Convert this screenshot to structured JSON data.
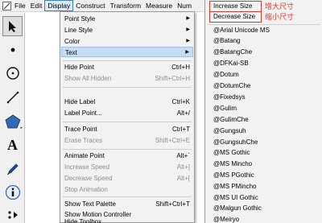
{
  "menubar": {
    "items": [
      "File",
      "Edit",
      "Display",
      "Construct",
      "Transform",
      "Measure",
      "Num"
    ]
  },
  "toolbox": {
    "tools": [
      "arrow-select-tool",
      "point-tool",
      "compass-tool",
      "straightedge-tool",
      "polygon-tool",
      "text-tool",
      "marker-tool",
      "information-tool",
      "custom-tool"
    ]
  },
  "display_menu": {
    "items": [
      {
        "label": "Point Style",
        "shortcut": "",
        "submenu": true,
        "enabled": true
      },
      {
        "label": "Line Style",
        "shortcut": "",
        "submenu": true,
        "enabled": true
      },
      {
        "label": "Color",
        "shortcut": "",
        "submenu": true,
        "enabled": true
      },
      {
        "label": "Text",
        "shortcut": "",
        "submenu": true,
        "enabled": true,
        "highlighted": true
      },
      {
        "label": "Hide Point",
        "shortcut": "Ctrl+H",
        "submenu": false,
        "enabled": true
      },
      {
        "label": "Show All Hidden",
        "shortcut": "Shift+Ctrl+H",
        "submenu": false,
        "enabled": false
      },
      {
        "label": "Hide Label",
        "shortcut": "Ctrl+K",
        "submenu": false,
        "enabled": true
      },
      {
        "label": "Label Point...",
        "shortcut": "Alt+/",
        "submenu": false,
        "enabled": true
      },
      {
        "label": "Trace Point",
        "shortcut": "Ctrl+T",
        "submenu": false,
        "enabled": true
      },
      {
        "label": "Erase Traces",
        "shortcut": "Shift+Ctrl+E",
        "submenu": false,
        "enabled": false
      },
      {
        "label": "Animate Point",
        "shortcut": "Alt+`",
        "submenu": false,
        "enabled": true
      },
      {
        "label": "Increase Speed",
        "shortcut": "Alt+]",
        "submenu": false,
        "enabled": false
      },
      {
        "label": "Decrease Speed",
        "shortcut": "Alt+[",
        "submenu": false,
        "enabled": false
      },
      {
        "label": "Stop Animation",
        "shortcut": "",
        "submenu": false,
        "enabled": false
      },
      {
        "label": "Show Text Palette",
        "shortcut": "Shift+Ctrl+T",
        "submenu": false,
        "enabled": true
      },
      {
        "label": "Show Motion Controller",
        "shortcut": "",
        "submenu": false,
        "enabled": true
      },
      {
        "label": "Hide Toolbox",
        "shortcut": "",
        "submenu": false,
        "enabled": true
      }
    ]
  },
  "text_submenu": {
    "increase": {
      "label": "Increase Size",
      "annotation": "增大尺寸"
    },
    "decrease": {
      "label": "Decrease Size",
      "annotation": "缩小尺寸"
    },
    "fonts": [
      "@Arial Unicode MS",
      "@Batang",
      "@BatangChe",
      "@DFKai-SB",
      "@Dotum",
      "@DotumChe",
      "@Fixedsys",
      "@Gulim",
      "@GulimChe",
      "@Gungsuh",
      "@GungsuhChe",
      "@MS Gothic",
      "@MS Mincho",
      "@MS PGothic",
      "@MS PMincho",
      "@MS UI Gothic",
      "@Malgun Gothic",
      "@Meiryo"
    ]
  },
  "colors": {
    "annotation_red": "#d9362b",
    "highlight_blue": "#c6dcf1"
  }
}
